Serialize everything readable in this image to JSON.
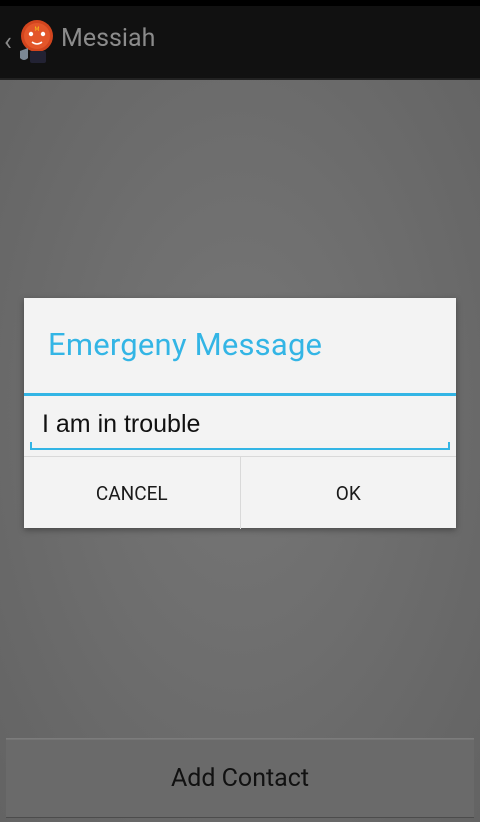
{
  "app": {
    "title": "Messiah"
  },
  "dialog": {
    "title": "Emergeny Message",
    "input_value": "I am in trouble",
    "cancel_label": "CANCEL",
    "ok_label": "OK"
  },
  "main": {
    "add_contact_label": "Add Contact"
  },
  "colors": {
    "accent": "#33b5e5",
    "actionbar": "#111111",
    "dialog_bg": "#f3f3f3"
  },
  "icons": {
    "back": "chevron-left-icon",
    "app": "messiah-app-icon"
  }
}
